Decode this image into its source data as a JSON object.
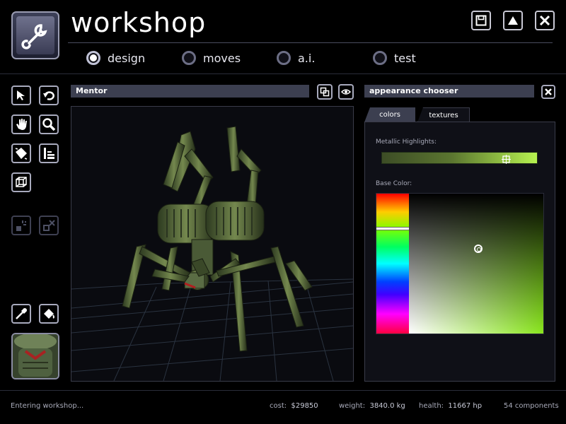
{
  "app": {
    "title": "workshop"
  },
  "header_buttons": [
    {
      "name": "save-button",
      "icon": "save-icon"
    },
    {
      "name": "up-button",
      "icon": "triangle-up-icon"
    },
    {
      "name": "close-button",
      "icon": "close-icon"
    }
  ],
  "tabs": [
    {
      "label": "design",
      "selected": true
    },
    {
      "label": "moves",
      "selected": false
    },
    {
      "label": "a.i.",
      "selected": false
    },
    {
      "label": "test",
      "selected": false
    }
  ],
  "tools": [
    {
      "icon": "arrow-pointer-icon",
      "enabled": true
    },
    {
      "icon": "undo-rotate-icon",
      "enabled": true
    },
    {
      "icon": "hand-icon",
      "enabled": true
    },
    {
      "icon": "magnifier-icon",
      "enabled": true
    },
    {
      "icon": "rotate-cube-icon",
      "enabled": true
    },
    {
      "icon": "scale-icon",
      "enabled": true
    },
    {
      "icon": "cube-frame-icon",
      "enabled": true
    },
    {
      "icon": "explode-icon",
      "enabled": false
    },
    {
      "icon": "delete-part-icon",
      "enabled": false
    },
    {
      "icon": "eyedropper-icon",
      "enabled": true
    },
    {
      "icon": "paint-bucket-icon",
      "enabled": true
    }
  ],
  "viewport": {
    "title": "Mentor"
  },
  "appearance": {
    "title": "appearance chooser",
    "tabs": [
      "colors",
      "textures"
    ],
    "active_tab": "colors",
    "metallic_label": "Metallic Highlights:",
    "metallic_value": 0.79,
    "base_color_label": "Base Color:",
    "hue_value": 0.24
  },
  "status": {
    "message": "Entering workshop...",
    "cost_label": "cost:",
    "cost_value": "$29850",
    "weight_label": "weight:",
    "weight_value": "3840.0 kg",
    "health_label": "health:",
    "health_value": "11667 hp",
    "components": "54 components"
  },
  "colors": {
    "accent_green": "#9ef23a",
    "panel_bar": "#3c3f50"
  }
}
